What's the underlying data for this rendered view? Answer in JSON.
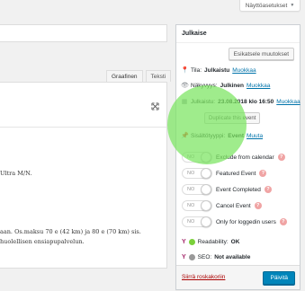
{
  "screen_options": {
    "label": "Näyttöasetukset"
  },
  "editor": {
    "tabs": [
      {
        "label": "Graafinen"
      },
      {
        "label": "Teksti"
      }
    ],
    "fullscreen_icon": "fullscreen-icon",
    "lines": [
      "Ultra M/N.",
      "aan. Os.maksu 70 e (42 km) ja 80 e (70 km) sis.",
      "huolellisen ensiapupalvelun."
    ]
  },
  "publish": {
    "title": "Julkaise",
    "preview_label": "Esikatsele muutokset",
    "status": {
      "label": "Tila:",
      "value": "Julkaistu",
      "link": "Muokkaa"
    },
    "visibility": {
      "label": "Näkyvyys:",
      "value": "Julkinen",
      "link": "Muokkaa"
    },
    "published": {
      "label": "Julkaistu:",
      "value": "23.08.2018 klo 16:50",
      "link": "Muokkaa"
    },
    "duplicate_label": "Duplicate this event",
    "content_type": {
      "label": "Sisältötyyppi:",
      "value": "Event",
      "link": "Muuta"
    },
    "toggles": [
      {
        "state": "NO",
        "label": "Exclude from calendar"
      },
      {
        "state": "NO",
        "label": "Featured Event"
      },
      {
        "state": "NO",
        "label": "Event Completed"
      },
      {
        "state": "NO",
        "label": "Cancel Event"
      },
      {
        "state": "NO",
        "label": "Only for loggedin users"
      }
    ],
    "readability": {
      "label": "Readability:",
      "value": "OK",
      "color": "#7ad03a"
    },
    "seo": {
      "label": "SEO:",
      "value": "Not available",
      "color": "#999999"
    },
    "trash_label": "Siirrä roskakoriin",
    "update_label": "Päivitä"
  },
  "colors": {
    "accent": "#0085ba",
    "link": "#0073aa",
    "trash": "#aa0000",
    "highlight": "#7ae460"
  }
}
